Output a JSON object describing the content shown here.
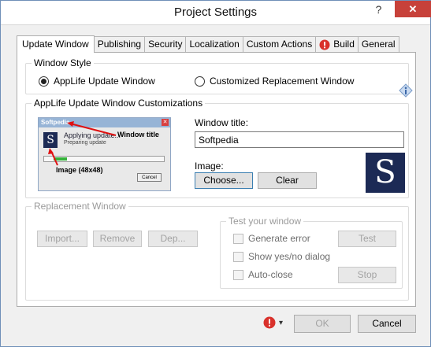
{
  "window": {
    "title": "Project Settings",
    "help_glyph": "?",
    "close_glyph": "✕"
  },
  "tabs": [
    {
      "label": "Update Window",
      "active": true
    },
    {
      "label": "Publishing"
    },
    {
      "label": "Security"
    },
    {
      "label": "Localization"
    },
    {
      "label": "Custom Actions"
    },
    {
      "label": "Build",
      "icon": "error-icon"
    },
    {
      "label": "General"
    }
  ],
  "window_style": {
    "legend": "Window Style",
    "option_applife": "AppLife Update Window",
    "option_custom": "Customized Replacement Window",
    "selected": "AppLife Update Window",
    "info_icon": "info-icon"
  },
  "customizations": {
    "legend": "AppLife Update Window Customizations",
    "preview": {
      "title": "Softpedia",
      "logo_letter": "S",
      "text1": "Applying update...",
      "text2": "Preparing update",
      "progress": 0.12,
      "cancel": "Cancel",
      "annotation_window_title": "Window title",
      "annotation_image": "Image (48x48)"
    },
    "window_title_label": "Window title:",
    "window_title_value": "Softpedia",
    "image_label": "Image:",
    "choose_button": "Choose...",
    "clear_button": "Clear",
    "logo_letter": "S"
  },
  "replacement": {
    "legend": "Replacement Window",
    "import_button": "Import...",
    "remove_button": "Remove",
    "dep_button": "Dep...",
    "test_group": {
      "legend": "Test your window",
      "generate_error": "Generate error",
      "show_yes_no": "Show yes/no dialog",
      "auto_close": "Auto-close",
      "test_button": "Test",
      "stop_button": "Stop"
    }
  },
  "footer": {
    "ok_button": "OK",
    "cancel_button": "Cancel",
    "error_icon": "error-icon",
    "dropdown_glyph": "▾"
  },
  "colors": {
    "close_red": "#c7413a",
    "logo_navy": "#1c2a55",
    "error_red": "#d9312b",
    "annotation_red": "#e01010"
  }
}
